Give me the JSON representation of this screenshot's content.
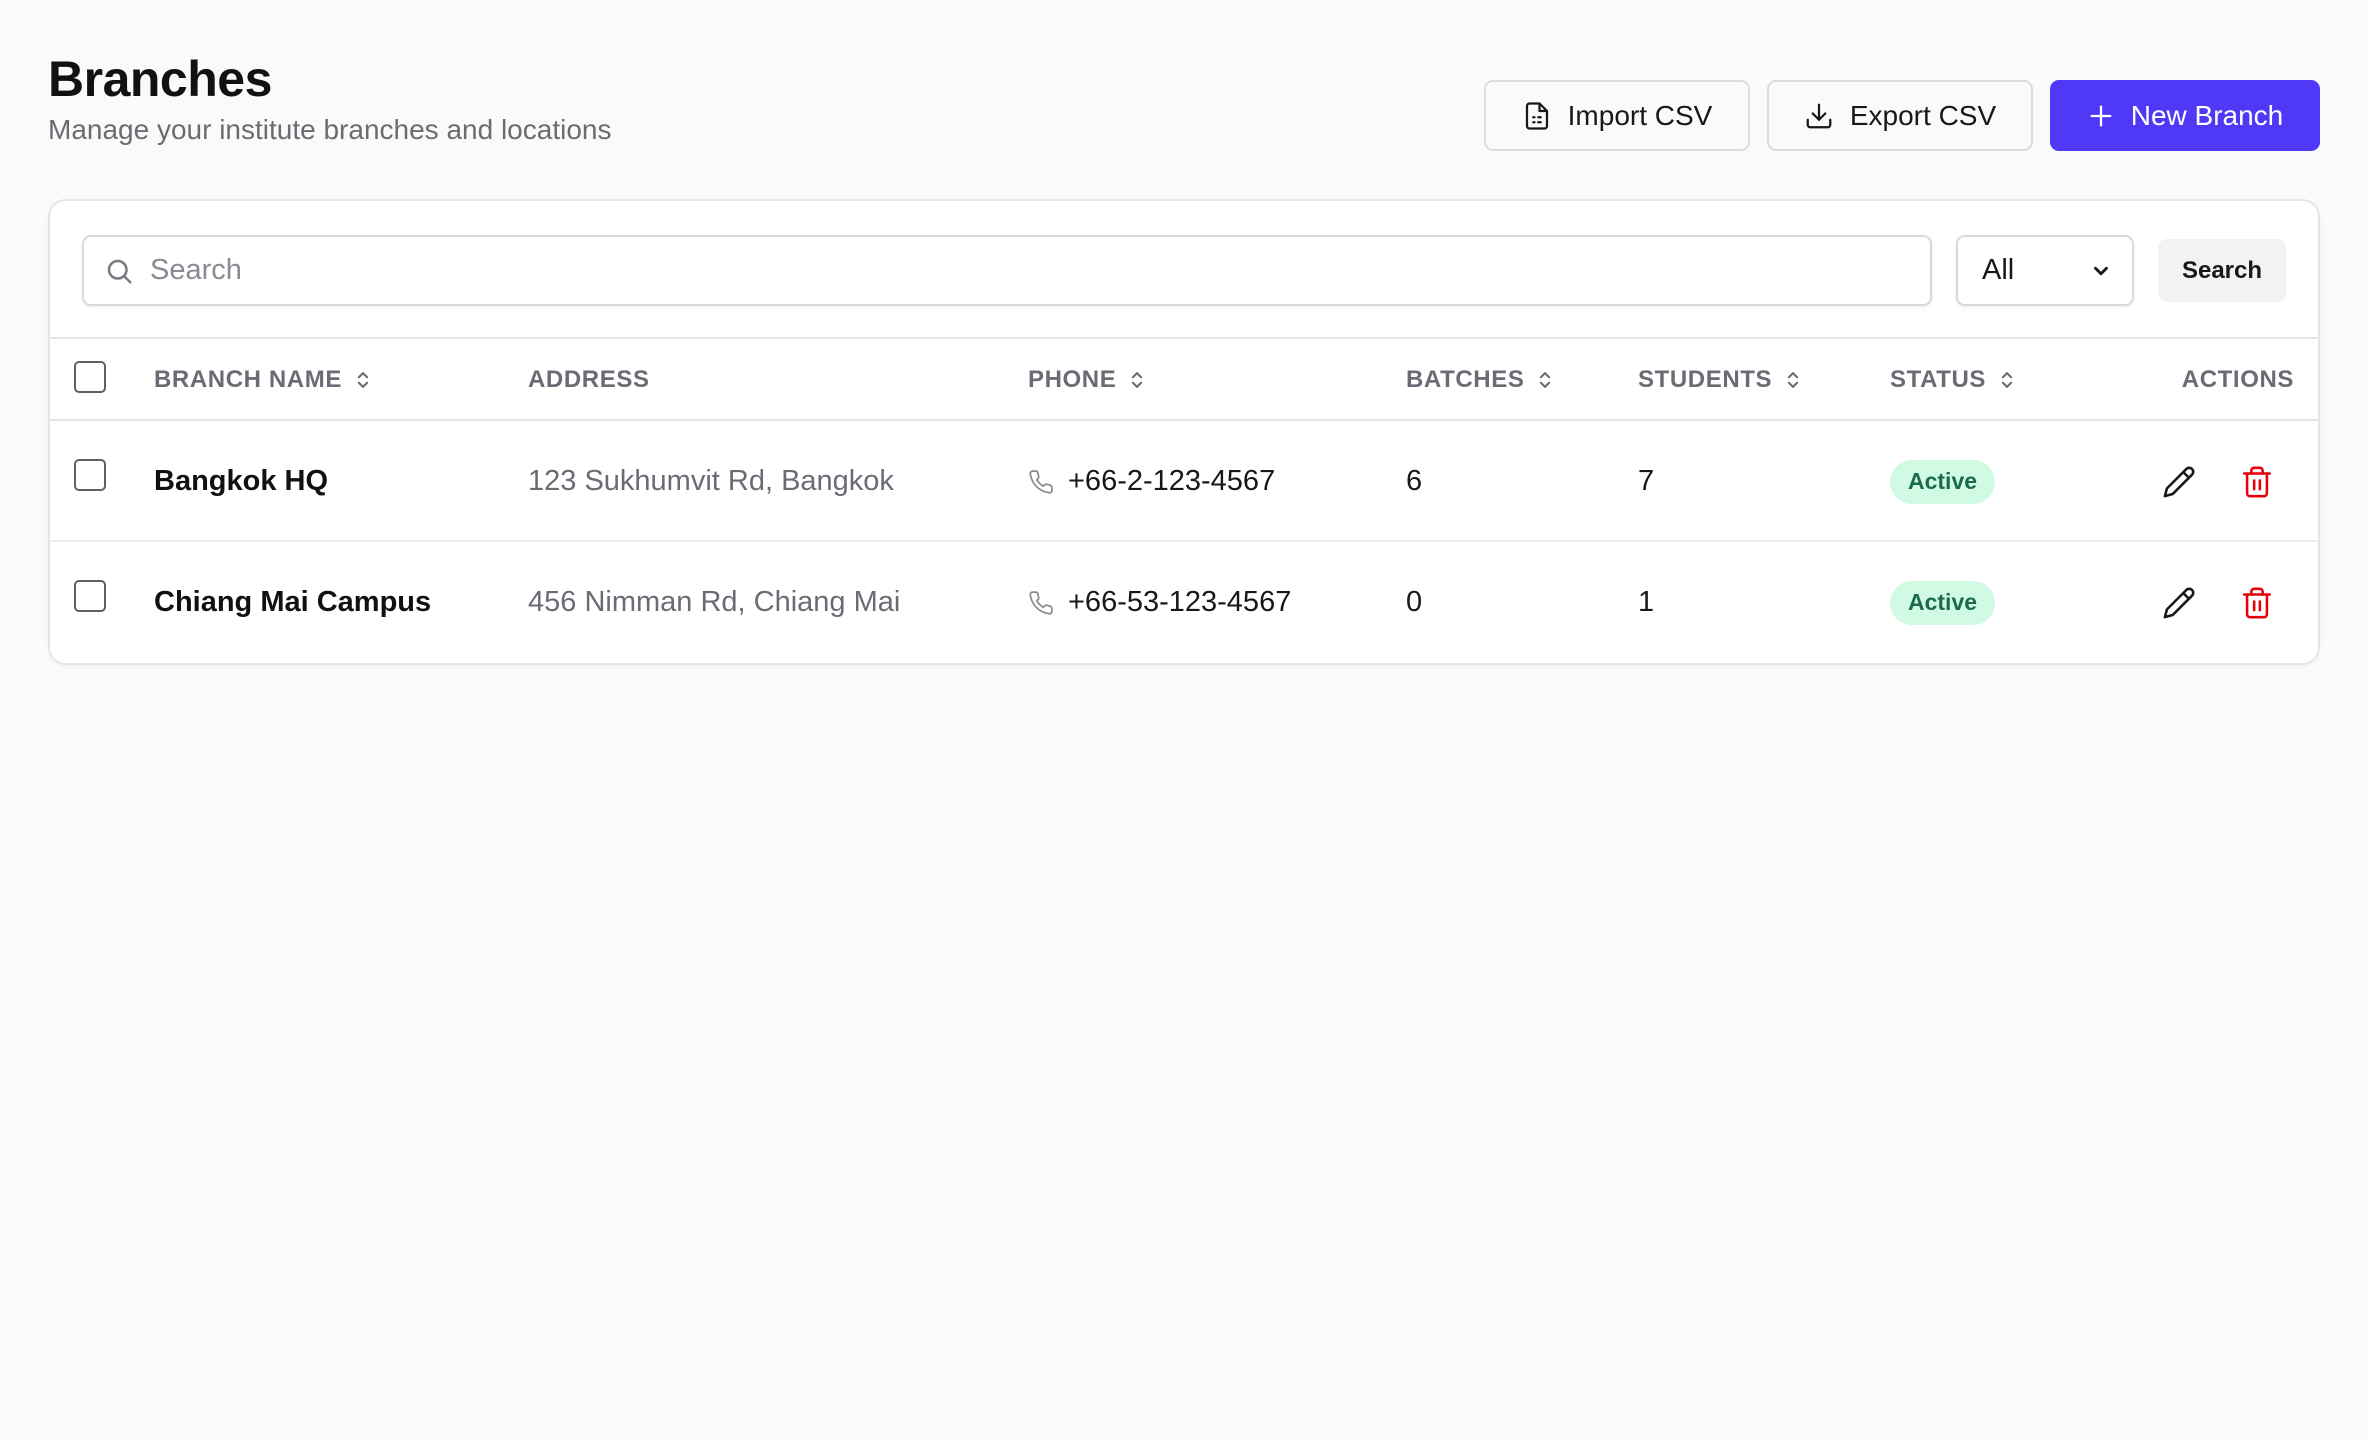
{
  "header": {
    "title": "Branches",
    "subtitle": "Manage your institute branches and locations",
    "import_label": "Import CSV",
    "export_label": "Export CSV",
    "new_label": "New Branch"
  },
  "toolbar": {
    "search_placeholder": "Search",
    "search_value": "",
    "status_filter": "All",
    "search_button": "Search"
  },
  "table": {
    "columns": {
      "name": "BRANCH NAME",
      "address": "ADDRESS",
      "phone": "PHONE",
      "batches": "BATCHES",
      "students": "STUDENTS",
      "status": "STATUS",
      "actions": "ACTIONS"
    },
    "rows": [
      {
        "name": "Bangkok HQ",
        "address": "123 Sukhumvit Rd, Bangkok",
        "phone": "+66-2-123-4567",
        "batches": "6",
        "students": "7",
        "status": "Active"
      },
      {
        "name": "Chiang Mai Campus",
        "address": "456 Nimman Rd, Chiang Mai",
        "phone": "+66-53-123-4567",
        "batches": "0",
        "students": "1",
        "status": "Active"
      }
    ]
  },
  "colors": {
    "primary": "#4f39f6",
    "danger": "#e7000b",
    "badge_bg": "#d1fae5",
    "badge_text": "#1b6b4b"
  },
  "icons": {
    "import": "file-text-icon",
    "export": "download-icon",
    "new": "plus-icon",
    "search": "search-icon",
    "sort": "chevrons-up-down-icon",
    "phone": "phone-icon",
    "edit": "pencil-icon",
    "delete": "trash-icon"
  }
}
